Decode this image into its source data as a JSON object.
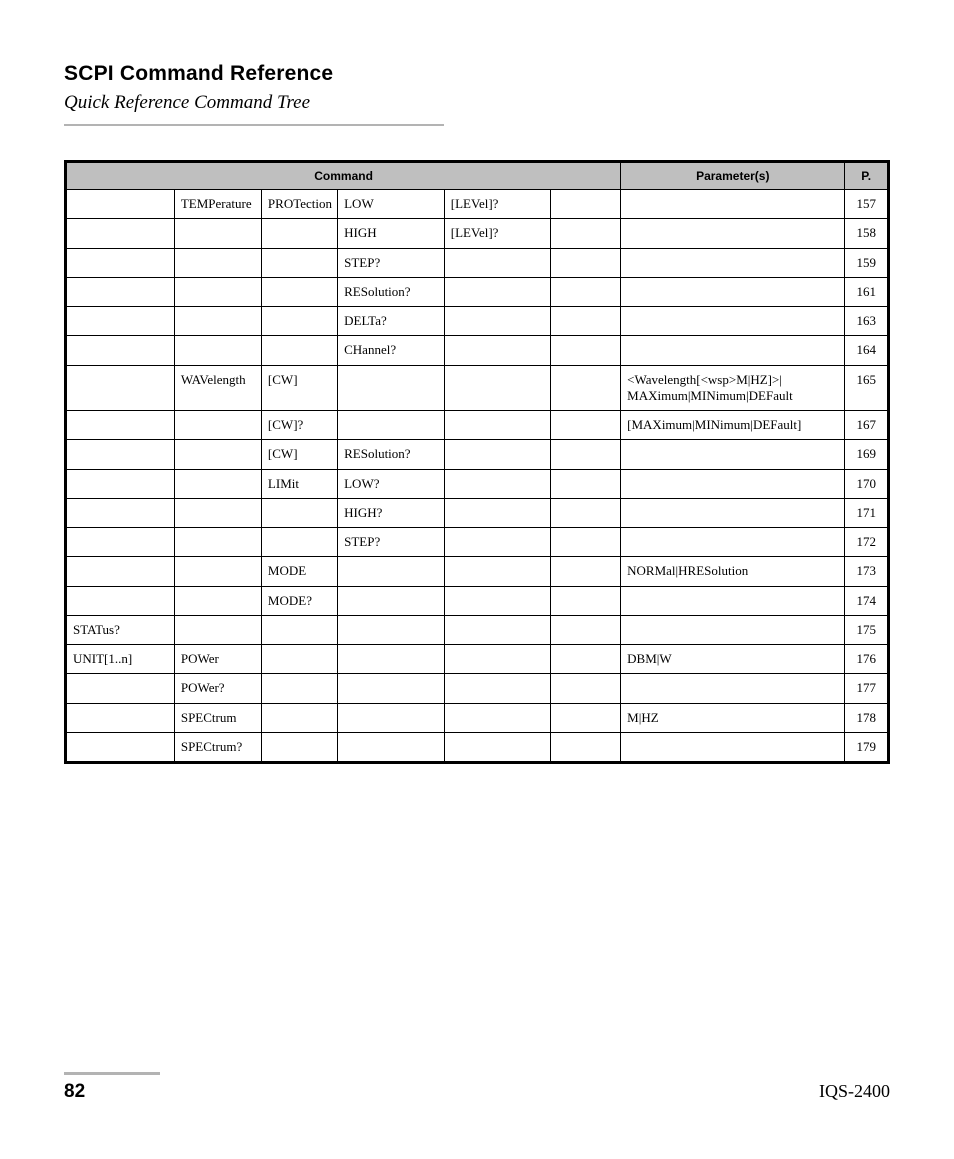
{
  "header": {
    "title": "SCPI Command Reference",
    "subtitle": "Quick Reference Command Tree"
  },
  "table": {
    "headers": {
      "command": "Command",
      "parameters": "Parameter(s)",
      "page": "P."
    },
    "rows": [
      {
        "c1": "",
        "c2": "TEMPerature",
        "c3": "PROTection",
        "c4": "LOW",
        "c5": "[LEVel]?",
        "c6": "",
        "param": "",
        "page": "157"
      },
      {
        "c1": "",
        "c2": "",
        "c3": "",
        "c4": "HIGH",
        "c5": "[LEVel]?",
        "c6": "",
        "param": "",
        "page": "158"
      },
      {
        "c1": "",
        "c2": "",
        "c3": "",
        "c4": "STEP?",
        "c5": "",
        "c6": "",
        "param": "",
        "page": "159"
      },
      {
        "c1": "",
        "c2": "",
        "c3": "",
        "c4": "RESolution?",
        "c5": "",
        "c6": "",
        "param": "",
        "page": "161"
      },
      {
        "c1": "",
        "c2": "",
        "c3": "",
        "c4": "DELTa?",
        "c5": "",
        "c6": "",
        "param": "",
        "page": "163"
      },
      {
        "c1": "",
        "c2": "",
        "c3": "",
        "c4": "CHannel?",
        "c5": "",
        "c6": "",
        "param": "",
        "page": "164"
      },
      {
        "c1": "",
        "c2": "WAVelength",
        "c3": "[CW]",
        "c4": "",
        "c5": "",
        "c6": "",
        "param": "<Wavelength[<wsp>M|HZ]>|\nMAXimum|MINimum|DEFault",
        "page": "165"
      },
      {
        "c1": "",
        "c2": "",
        "c3": "[CW]?",
        "c4": "",
        "c5": "",
        "c6": "",
        "param": "[MAXimum|MINimum|DEFault]",
        "page": "167"
      },
      {
        "c1": "",
        "c2": "",
        "c3": "[CW]",
        "c4": "RESolution?",
        "c5": "",
        "c6": "",
        "param": "",
        "page": "169"
      },
      {
        "c1": "",
        "c2": "",
        "c3": "LIMit",
        "c4": "LOW?",
        "c5": "",
        "c6": "",
        "param": "",
        "page": "170"
      },
      {
        "c1": "",
        "c2": "",
        "c3": "",
        "c4": "HIGH?",
        "c5": "",
        "c6": "",
        "param": "",
        "page": "171"
      },
      {
        "c1": "",
        "c2": "",
        "c3": "",
        "c4": "STEP?",
        "c5": "",
        "c6": "",
        "param": "",
        "page": "172"
      },
      {
        "c1": "",
        "c2": "",
        "c3": "MODE",
        "c4": "",
        "c5": "",
        "c6": "",
        "param": "NORMal|HRESolution",
        "page": "173"
      },
      {
        "c1": "",
        "c2": "",
        "c3": "MODE?",
        "c4": "",
        "c5": "",
        "c6": "",
        "param": "",
        "page": "174"
      },
      {
        "c1": "STATus?",
        "c2": "",
        "c3": "",
        "c4": "",
        "c5": "",
        "c6": "",
        "param": "",
        "page": "175"
      },
      {
        "c1": "UNIT[1..n]",
        "c2": "POWer",
        "c3": "",
        "c4": "",
        "c5": "",
        "c6": "",
        "param": "DBM|W",
        "page": "176"
      },
      {
        "c1": "",
        "c2": "POWer?",
        "c3": "",
        "c4": "",
        "c5": "",
        "c6": "",
        "param": "",
        "page": "177"
      },
      {
        "c1": "",
        "c2": "SPECtrum",
        "c3": "",
        "c4": "",
        "c5": "",
        "c6": "",
        "param": "M|HZ",
        "page": "178"
      },
      {
        "c1": "",
        "c2": "SPECtrum?",
        "c3": "",
        "c4": "",
        "c5": "",
        "c6": "",
        "param": "",
        "page": "179"
      }
    ]
  },
  "footer": {
    "page_number": "82",
    "doc_id": "IQS-2400"
  }
}
